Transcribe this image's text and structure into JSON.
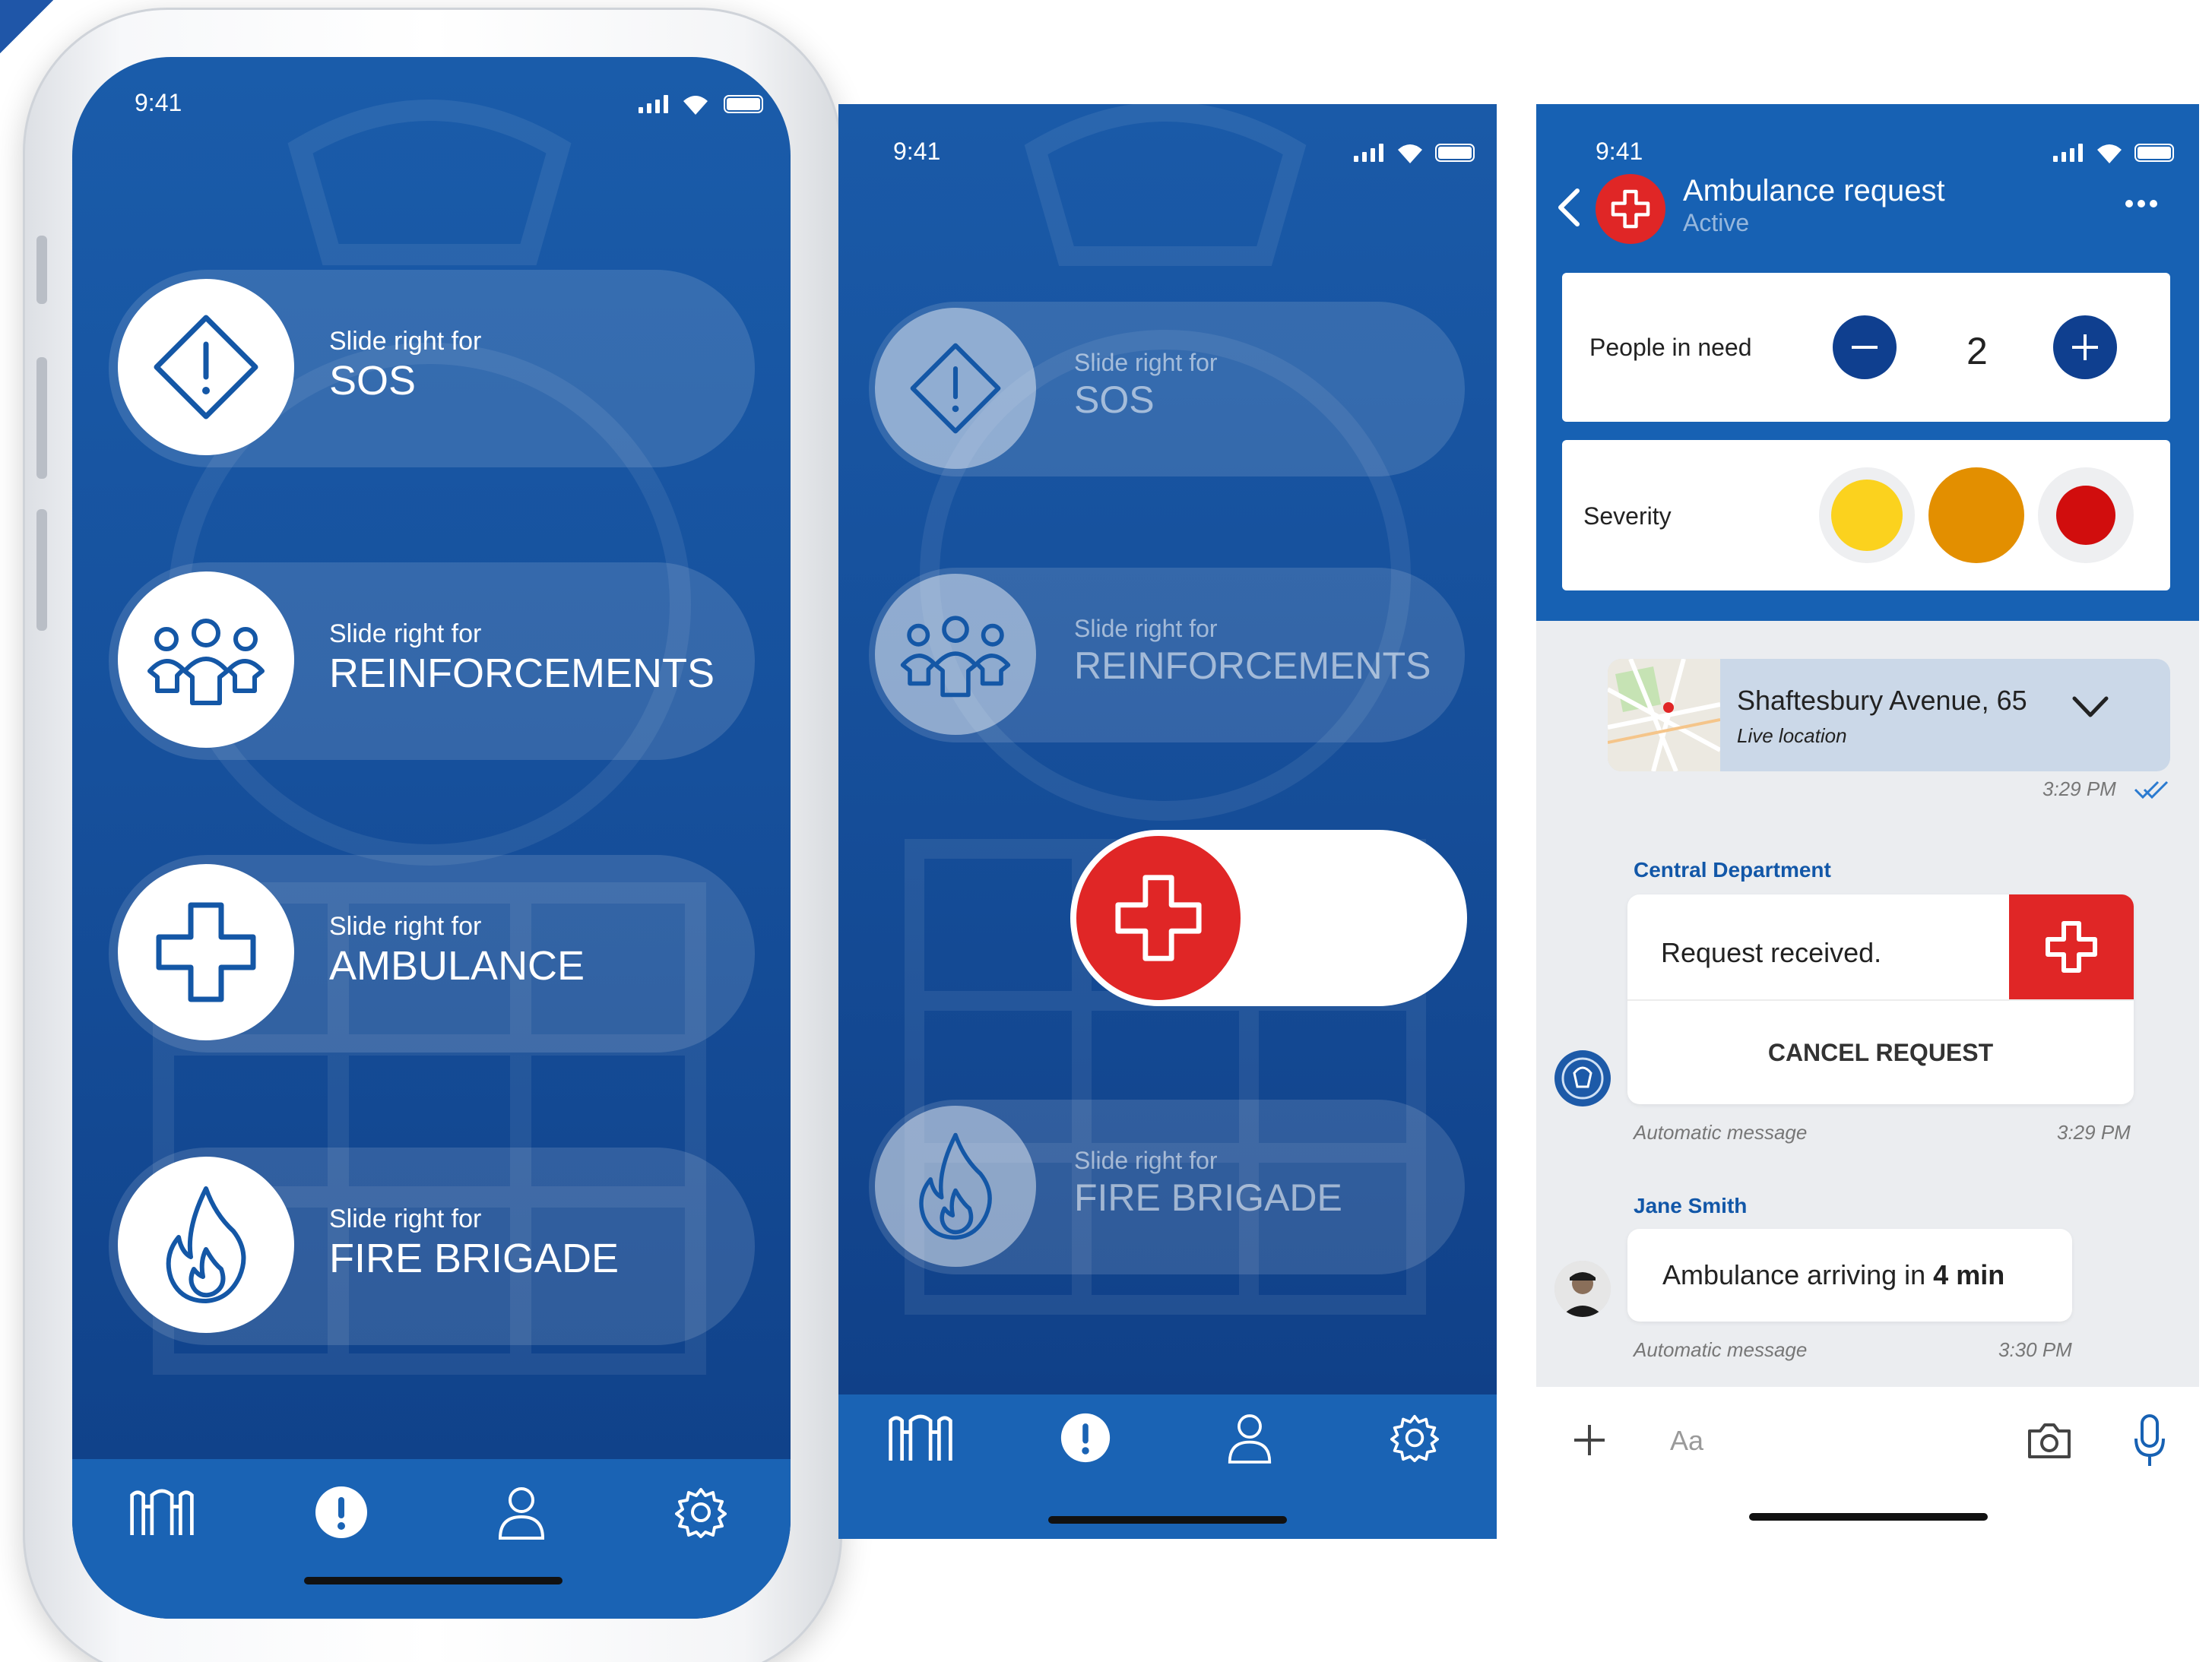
{
  "status_bar": {
    "time": "9:41"
  },
  "screen_home": {
    "options": [
      {
        "hint": "Slide right for",
        "label": "SOS",
        "icon": "warning-diamond-icon"
      },
      {
        "hint": "Slide right for",
        "label": "REINFORCEMENTS",
        "icon": "group-icon"
      },
      {
        "hint": "Slide right for",
        "label": "AMBULANCE",
        "icon": "medical-cross-icon"
      },
      {
        "hint": "Slide right for",
        "label": "FIRE BRIGADE",
        "icon": "flame-icon"
      }
    ],
    "tabs": [
      "crest-logo-icon",
      "alert-icon",
      "profile-icon",
      "settings-icon"
    ]
  },
  "screen_sliding": {
    "active_option": "AMBULANCE",
    "active_color": "#e02626"
  },
  "screen_chat": {
    "title": "Ambulance request",
    "subtitle": "Active",
    "people_label": "People in need",
    "people_count": "2",
    "severity_label": "Severity",
    "severity_colors": [
      "#fbd21e",
      "#e38f00",
      "#d10d0d"
    ],
    "location": {
      "address": "Shaftesbury Avenue, 65",
      "caption": "Live location",
      "time": "3:29 PM"
    },
    "messages": [
      {
        "sender": "Central Department",
        "text": "Request received.",
        "action": "CANCEL REQUEST",
        "meta": "Automatic message",
        "time": "3:29 PM"
      },
      {
        "sender": "Jane Smith",
        "text_prefix": "Ambulance arriving in ",
        "text_bold": "4 min",
        "meta": "Automatic message",
        "time": "3:30 PM"
      }
    ],
    "input_placeholder": "Aa"
  },
  "colors": {
    "brand_blue": "#1761b3",
    "dark_blue": "#0f3f8f",
    "alert_red": "#e02626"
  }
}
